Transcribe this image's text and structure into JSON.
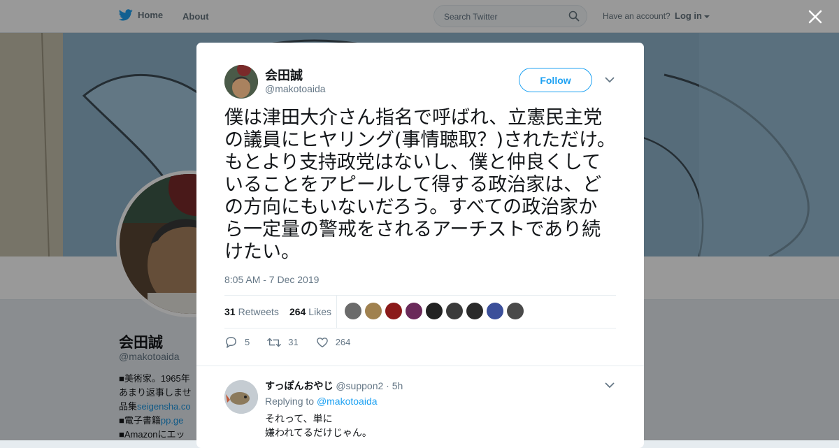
{
  "nav": {
    "home_label": "Home",
    "about_label": "About",
    "search_placeholder": "Search Twitter",
    "have_account": "Have an account?",
    "login_label": "Log in"
  },
  "profile": {
    "name": "会田誠",
    "handle": "@makotoaida",
    "bio_lines": [
      "■美術家。1965年",
      "あまり返事しませ",
      "品集seigensha.co",
      "■電子書籍pp.ge",
      "■Amazonにエッ"
    ],
    "bio_links": [
      "seigensha.co",
      "pp.ge"
    ]
  },
  "tweet": {
    "author_name": "会田誠",
    "author_handle": "@makotoaida",
    "follow_label": "Follow",
    "text": "僕は津田大介さん指名で呼ばれ、立憲民主党の議員にヒヤリング(事情聴取？)されただけ。もとより支持政党はないし、僕と仲良くしていることをアピールして得する政治家は、どの方向にもいないだろう。すべての政治家から一定量の警戒をされるアーチストであり続けたい。",
    "timestamp": "8:05 AM - 7 Dec 2019",
    "retweets_count": "31",
    "retweets_label": "Retweets",
    "likes_count": "264",
    "likes_label": "Likes",
    "reply_count": "5",
    "retweet_action_count": "31",
    "like_action_count": "264",
    "liker_colors": [
      "#6b6b6b",
      "#a0814f",
      "#8b1a1a",
      "#6a2a5a",
      "#222222",
      "#3a3a3a",
      "#2a2a2a",
      "#3b4f9a",
      "#4a4a4a"
    ]
  },
  "reply": {
    "name": "すっぽんおやじ",
    "handle": "@suppon2",
    "time": "· 5h",
    "replying_label": "Replying to",
    "replying_to": "@makotoaida",
    "text": "それって、単に\n嫌われてるだけじゃん。"
  },
  "colors": {
    "accent": "#1da1f2",
    "link": "#1b95e0",
    "muted": "#657786"
  }
}
